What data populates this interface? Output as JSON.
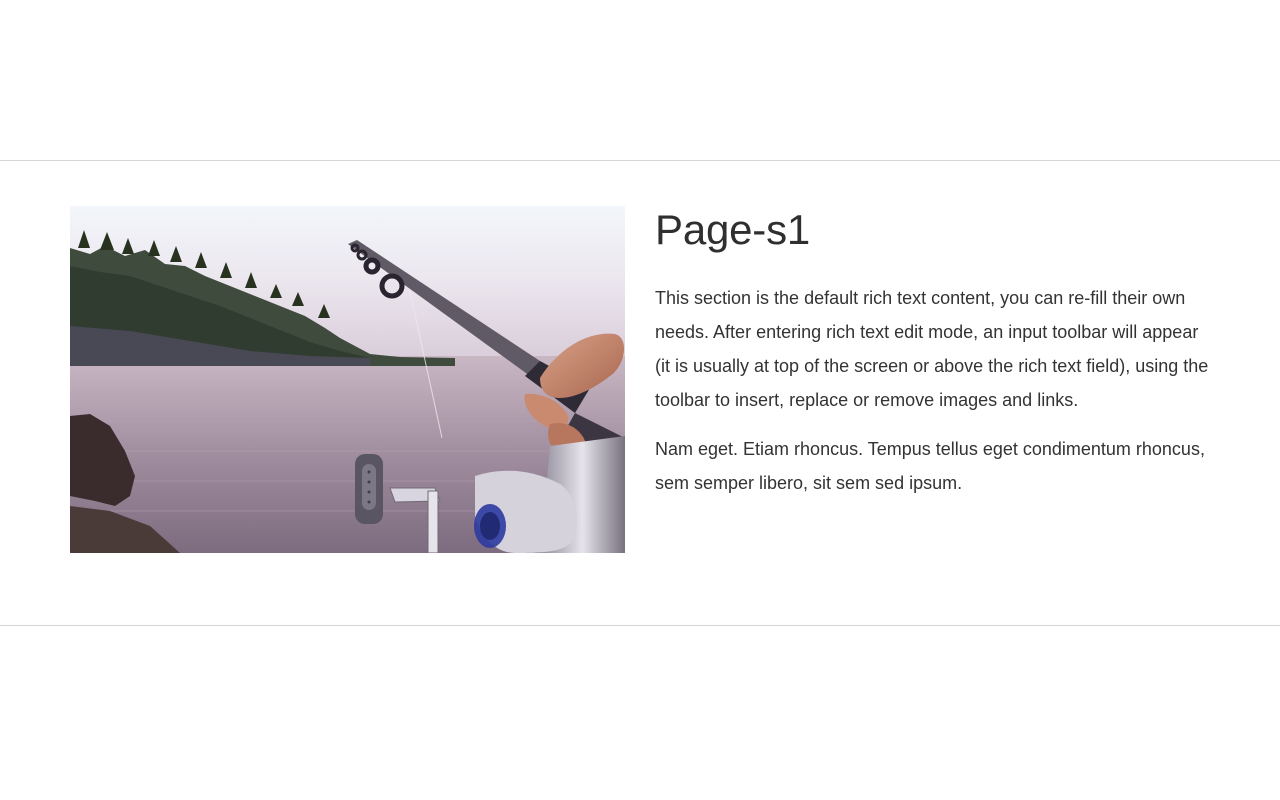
{
  "section": {
    "title": "Page-s1",
    "paragraphs": [
      "This section is the default rich text content, you can re-fill their own needs. After entering rich text edit mode, an input toolbar will appear (it is usually at top of the screen or above the rich text field), using the toolbar to insert, replace or remove images and links.",
      "Nam eget. Etiam rhoncus. Tempus tellus eget condimentum rhoncus, sem semper libero, sit sem sed ipsum."
    ],
    "image": {
      "alt": "",
      "icon": "photo-fishing-rod-by-lake"
    }
  },
  "colors": {
    "divider": "#d6d6d6",
    "text": "#333333",
    "title": "#2f2f2f",
    "background": "#ffffff"
  }
}
